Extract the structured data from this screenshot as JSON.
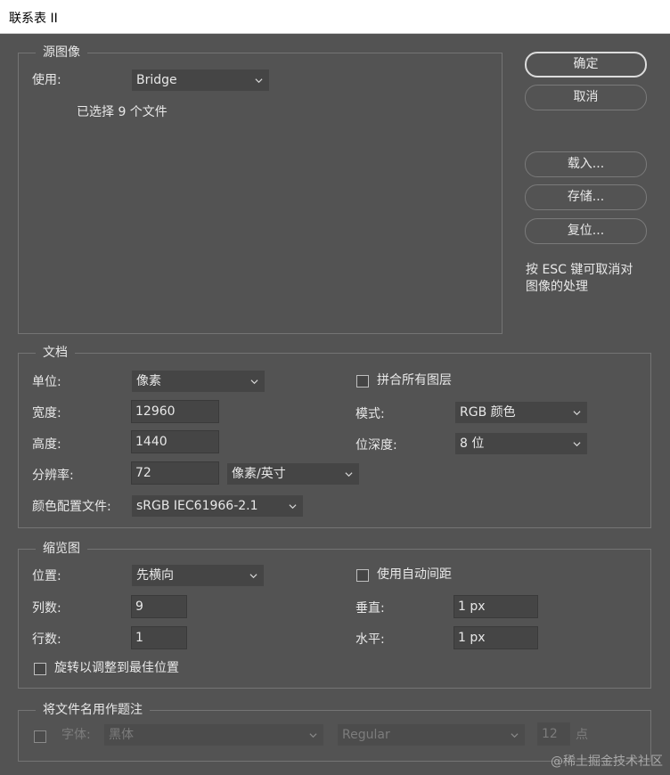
{
  "window": {
    "title": "联系表 II"
  },
  "source": {
    "legend": "源图像",
    "use_label": "使用:",
    "use_value": "Bridge",
    "selection_text": "已选择 9 个文件"
  },
  "buttons": {
    "ok": "确定",
    "cancel": "取消",
    "load": "载入...",
    "save": "存储...",
    "reset": "复位..."
  },
  "hint": {
    "line1": "按 ESC 键可取消对",
    "line2": "图像的处理"
  },
  "document": {
    "legend": "文档",
    "unit_label": "单位:",
    "unit_value": "像素",
    "width_label": "宽度:",
    "width_value": "12960",
    "height_label": "高度:",
    "height_value": "1440",
    "resolution_label": "分辨率:",
    "resolution_value": "72",
    "resolution_unit": "像素/英寸",
    "profile_label": "颜色配置文件:",
    "profile_value": "sRGB IEC61966-2.1",
    "flatten_label": "拼合所有图层",
    "flatten_checked": false,
    "mode_label": "模式:",
    "mode_value": "RGB 颜色",
    "bitdepth_label": "位深度:",
    "bitdepth_value": "8 位"
  },
  "thumbnails": {
    "legend": "缩览图",
    "position_label": "位置:",
    "position_value": "先横向",
    "columns_label": "列数:",
    "columns_value": "9",
    "rows_label": "行数:",
    "rows_value": "1",
    "rotate_label": "旋转以调整到最佳位置",
    "rotate_checked": false,
    "auto_spacing_label": "使用自动间距",
    "auto_spacing_checked": false,
    "vertical_label": "垂直:",
    "vertical_value": "1 px",
    "horizontal_label": "水平:",
    "horizontal_value": "1 px"
  },
  "caption": {
    "legend": "将文件名用作题注",
    "font_label": "字体:",
    "font_value": "黑体",
    "style_value": "Regular",
    "size_value": "12",
    "size_unit": "点"
  },
  "watermark": "@稀土掘金技术社区",
  "icons": {
    "chevron": "chevron-down-icon"
  },
  "colors": {
    "background": "#535353",
    "field": "#454545",
    "text": "#e8e8e8"
  }
}
